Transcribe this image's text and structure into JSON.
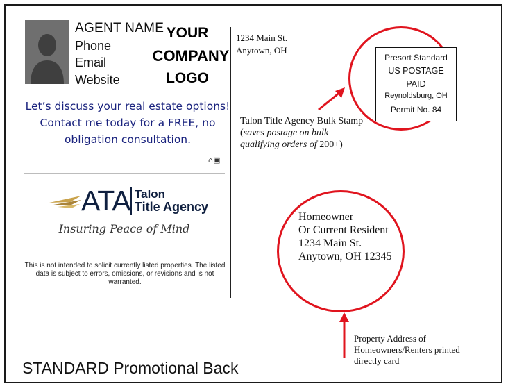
{
  "agent": {
    "name": "AGENT NAME",
    "phone": "Phone",
    "email": "Email",
    "website": "Website"
  },
  "company_logo": {
    "line1": "YOUR",
    "line2": "COMPANY",
    "line3": "LOGO"
  },
  "promo_text": "Let’s discuss your real estate options! Contact me today for a FREE, no obligation consultation.",
  "equal_housing_icons": "⌂▣",
  "ata_logo": {
    "letters": "ATA",
    "name_line1": "Talon",
    "name_line2": "Title Agency",
    "tagline": "Insuring Peace of Mind"
  },
  "disclaimer": "This is not intended to solicit currently listed properties. The listed data is subject to errors, omissions, or revisions and is not warranted.",
  "return_address": {
    "line1": "1234 Main St.",
    "line2": "Anytown, OH"
  },
  "postage_stamp": {
    "line1": "Presort Standard",
    "line2": "US POSTAGE",
    "line3": "PAID",
    "line4": "Reynoldsburg, OH",
    "line5": "Permit No. 84"
  },
  "stamp_note": {
    "plain": "Talon Title Agency Bulk Stamp (",
    "italic": "saves postage on bulk qualifying orders of",
    "end": " 200+)"
  },
  "mailing_address": {
    "line1": "Homeowner",
    "line2": "Or Current Resident",
    "line3": "1234 Main St.",
    "line4": "Anytown, OH 12345"
  },
  "property_note": "Property Address of Homeowners/Renters printed directly card",
  "footer_title": "STANDARD Promotional Back",
  "colors": {
    "accent_red": "#e0141e",
    "promo_blue": "#1a237e",
    "logo_navy": "#0f1f3f",
    "logo_gold": "#c9a24a"
  }
}
